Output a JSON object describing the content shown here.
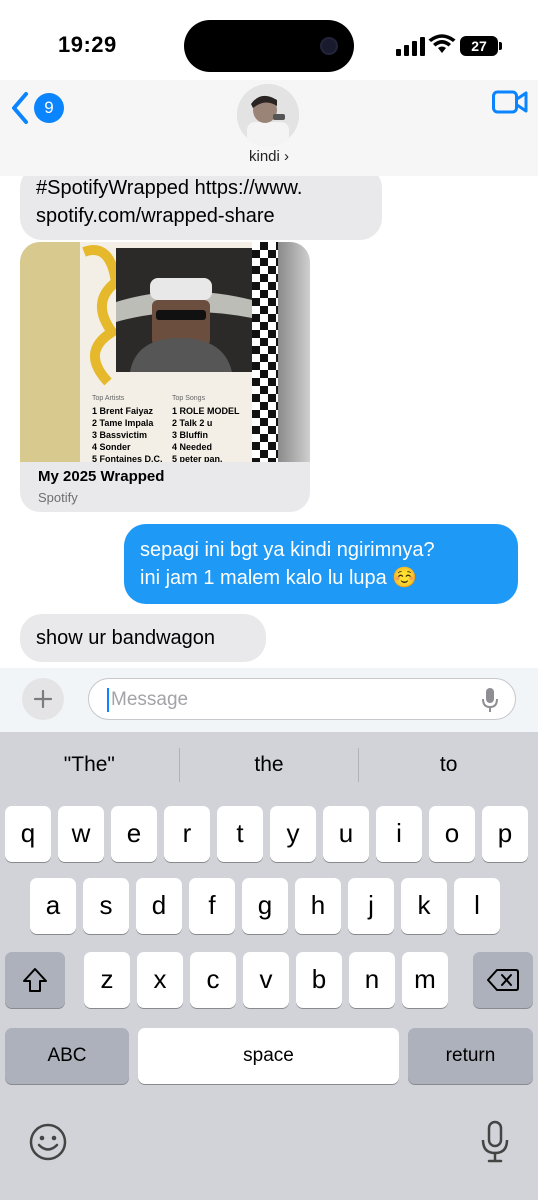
{
  "status": {
    "time": "19:29",
    "battery": "27"
  },
  "header": {
    "back_count": "9",
    "contact_name": "kindi ›"
  },
  "messages": {
    "m1_line1": "#SpotifyWrapped https://www.",
    "m1_line2": "spotify.com/wrapped-share",
    "card": {
      "title": "My 2025 Wrapped",
      "subtitle": "Spotify",
      "top_artists_label": "Top Artists",
      "top_songs_label": "Top Songs",
      "artists": [
        "1  Brent Faiyaz",
        "2  Tame Impala",
        "3  Bassvictim",
        "4  Sonder",
        "5  Fontaines D.C."
      ],
      "songs": [
        "1  ROLE MODEL",
        "2  Talk 2 u",
        "3  Bluffin",
        "4  Needed",
        "5  peter pan."
      ]
    },
    "m3_line1": "sepagi ini bgt ya kindi ngirimnya?",
    "m3_line2": "ini jam 1 malem kalo lu lupa ☺️",
    "m4": "show ur bandwagon"
  },
  "input": {
    "placeholder": "Message"
  },
  "keyboard": {
    "suggestions": [
      "\"The\"",
      "the",
      "to"
    ],
    "row1": [
      "q",
      "w",
      "e",
      "r",
      "t",
      "y",
      "u",
      "i",
      "o",
      "p"
    ],
    "row2": [
      "a",
      "s",
      "d",
      "f",
      "g",
      "h",
      "j",
      "k",
      "l"
    ],
    "row3": [
      "z",
      "x",
      "c",
      "v",
      "b",
      "n",
      "m"
    ],
    "abc_label": "ABC",
    "space_label": "space",
    "return_label": "return"
  },
  "colors": {
    "outgoing": "#1e99f5",
    "incoming": "#e9e9eb",
    "accent": "#0a84ff"
  },
  "icons": [
    "signal-icon",
    "wifi-icon",
    "battery-icon",
    "back-chevron-icon",
    "facetime-icon",
    "plus-icon",
    "mic-icon",
    "shift-icon",
    "backspace-icon",
    "emoji-icon",
    "dictation-icon"
  ]
}
